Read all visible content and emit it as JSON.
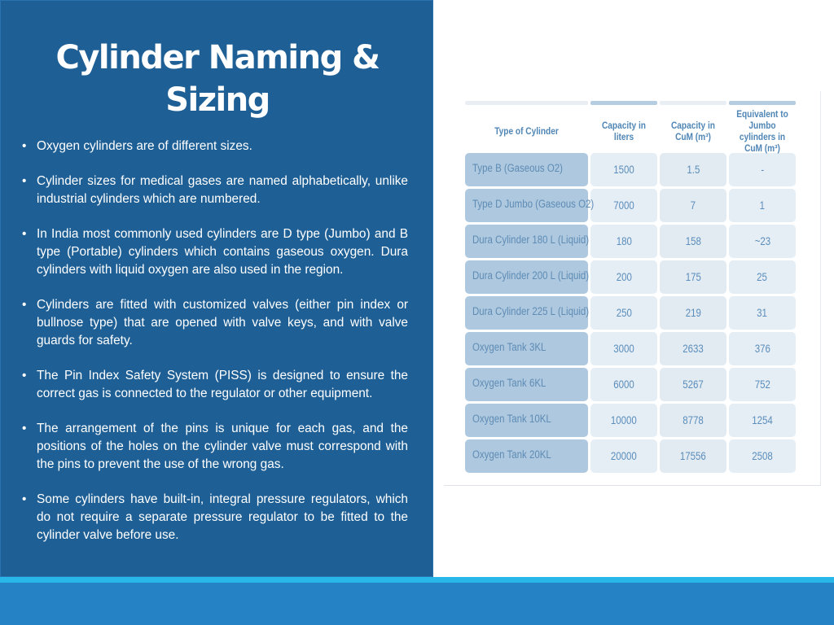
{
  "slide": {
    "title_line1": "Cylinder Naming &",
    "title_line2": "Sizing",
    "bullet_glyph": "•",
    "bullets": [
      "Oxygen cylinders are of different sizes.",
      "Cylinder sizes for medical gases are named alphabetically, unlike industrial cylinders which are numbered.",
      "In India most commonly used cylinders are D type (Jumbo) and B type (Portable) cylinders which contains gaseous oxygen. Dura cylinders with liquid oxygen are also used in the region.",
      "Cylinders are fitted with customized valves (either pin index or bullnose type) that are opened with valve keys, and with valve guards for safety.",
      "The Pin Index Safety System (PISS) is designed to ensure the correct gas is connected to the regulator or other equipment.",
      "The arrangement of the pins is unique for each gas, and the positions of the holes on the cylinder valve must correspond with the pins to prevent the use of the wrong gas.",
      "Some cylinders have built-in, integral pressure regulators, which do not require a separate pressure regulator to be fitted to the cylinder valve before use."
    ]
  },
  "table": {
    "headers": [
      "Type of Cylinder",
      "Capacity in liters",
      "Capacity in CuM (m³)",
      "Equivalent to Jumbo cylinders in CuM (m³)"
    ],
    "rows": [
      [
        "Type B (Gaseous O2)",
        "1500",
        "1.5",
        "-"
      ],
      [
        "Type D Jumbo (Gaseous O2)",
        "7000",
        "7",
        "1"
      ],
      [
        "Dura Cylinder 180 L (Liquid)",
        "180",
        "158",
        "~23"
      ],
      [
        "Dura Cylinder 200 L (Liquid)",
        "200",
        "175",
        "25"
      ],
      [
        "Dura Cylinder 225 L (Liquid)",
        "250",
        "219",
        "31"
      ],
      [
        "Oxygen Tank 3KL",
        "3000",
        "2633",
        "376"
      ],
      [
        "Oxygen Tank 6KL",
        "6000",
        "5267",
        "752"
      ],
      [
        "Oxygen Tank 10KL",
        "10000",
        "8778",
        "1254"
      ],
      [
        "Oxygen Tank 20KL",
        "20000",
        "17556",
        "2508"
      ]
    ]
  },
  "colors": {
    "panel_bg": "#1e5f95",
    "bottom_bar": "#2482c5",
    "accent_line": "#29b6e8",
    "table_header_text": "#4f86b6",
    "first_col_bg": "#adc8df",
    "data_cell_bg": "#e6eef5"
  }
}
